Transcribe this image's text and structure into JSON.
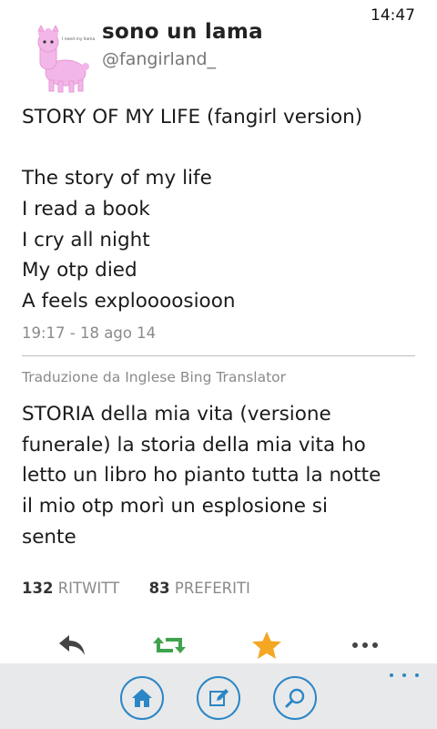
{
  "status_bar": {
    "time": "14:47"
  },
  "profile": {
    "display_name": "sono un lama",
    "handle": "@fangirland_",
    "avatar_caption": "I need my llama"
  },
  "tweet": {
    "lines": [
      "STORY OF MY LIFE (fangirl version)",
      "",
      "The story of my life",
      "I read a book",
      "I cry all night",
      "My otp died",
      "A feels exploooosioon"
    ],
    "timestamp": "19:17 - 18 ago 14"
  },
  "translation": {
    "label": "Traduzione da Inglese Bing Translator",
    "lines": [
      "STORIA della mia vita (versione",
      "funerale) la storia della mia vita ho",
      "letto un libro ho pianto tutta la notte",
      "il mio otp morì un esplosione si",
      "sente"
    ]
  },
  "stats": {
    "retweets_count": "132",
    "retweets_label": "RITWITT",
    "favorites_count": "83",
    "favorites_label": "PREFERITI"
  },
  "actions": [
    {
      "icon": "reply-icon",
      "color": "#444444"
    },
    {
      "icon": "retweet-icon",
      "color": "#3fa34d"
    },
    {
      "icon": "favorite-star-icon",
      "color": "#f5a623"
    },
    {
      "icon": "more-icon",
      "color": "#444444"
    }
  ],
  "appbar": {
    "buttons": [
      "home-icon",
      "compose-icon",
      "search-icon"
    ],
    "accent_color": "#2b86c6"
  }
}
